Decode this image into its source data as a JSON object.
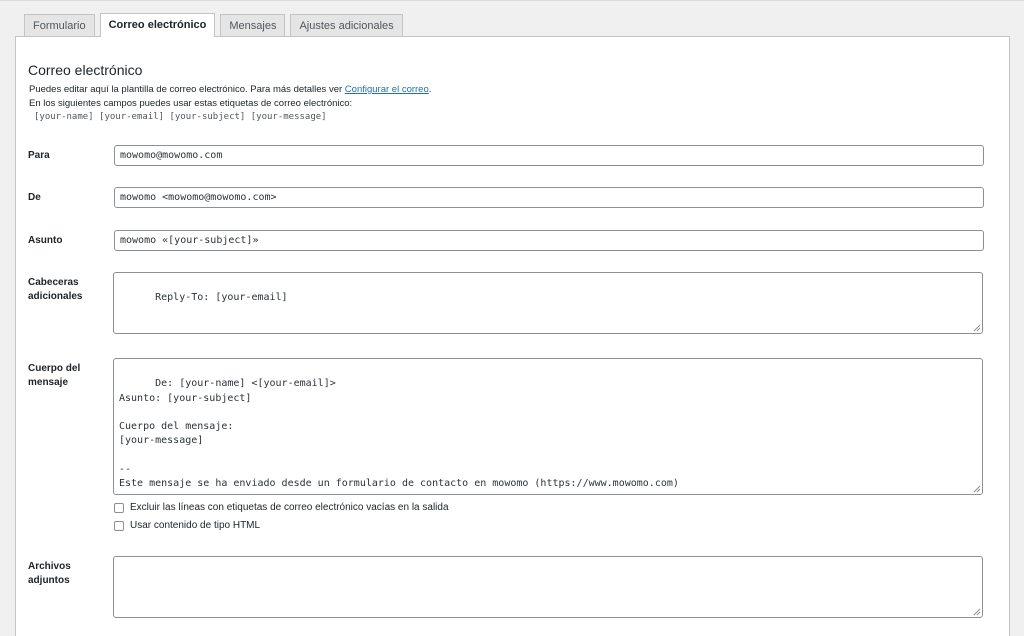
{
  "tabs": [
    {
      "label": "Formulario"
    },
    {
      "label": "Correo electrónico"
    },
    {
      "label": "Mensajes"
    },
    {
      "label": "Ajustes adicionales"
    }
  ],
  "section": {
    "title": "Correo electrónico",
    "desc_line1_prefix": "Puedes editar aquí la plantilla de correo electrónico. Para más detalles ver ",
    "desc_line1_link": "Configurar el correo",
    "desc_line1_suffix": ".",
    "desc_line2": "En los siguientes campos puedes usar estas etiquetas de correo electrónico:",
    "tags": "[your-name] [your-email] [your-subject] [your-message]"
  },
  "fields": {
    "para": {
      "label": "Para",
      "value": "mowomo@mowomo.com"
    },
    "de": {
      "label": "De",
      "value": "mowomo <mowomo@mowomo.com>"
    },
    "asunto": {
      "label": "Asunto",
      "value": "mowomo «[your-subject]»"
    },
    "cabeceras": {
      "label_1": "Cabeceras",
      "label_2": "adicionales",
      "value": "Reply-To: [your-email]"
    },
    "cuerpo": {
      "label_1": "Cuerpo del",
      "label_2": "mensaje",
      "value": "De: [your-name] <[your-email]>\nAsunto: [your-subject]\n\nCuerpo del mensaje:\n[your-message]\n\n--\nEste mensaje se ha enviado desde un formulario de contacto en mowomo (https://www.mowomo.com)"
    },
    "archivos": {
      "label_1": "Archivos",
      "label_2": "adjuntos",
      "value": ""
    }
  },
  "options": {
    "exclude_blank": {
      "label": "Excluir las líneas con etiquetas de correo electrónico vacías en la salida",
      "checked": false
    },
    "use_html": {
      "label": "Usar contenido de tipo HTML",
      "checked": false
    }
  }
}
